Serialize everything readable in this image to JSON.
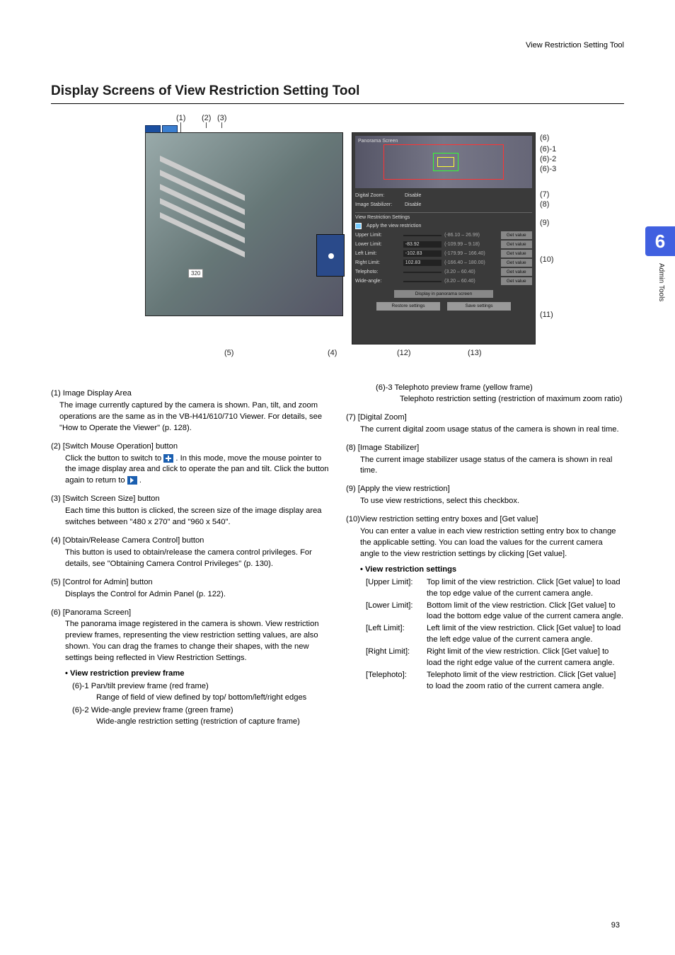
{
  "breadcrumb": "View Restriction Setting Tool",
  "section_title": "Display Screens of View Restriction Setting Tool",
  "chapter_tab": "6",
  "side_label": "Admin Tools",
  "page_number": "93",
  "figure": {
    "size_badge": "320",
    "panel": {
      "pano_title": "Panorama Screen",
      "dz_label": "Digital Zoom:",
      "dz_value": "Disable",
      "is_label": "Image Stabilizer:",
      "is_value": "Disable",
      "vrs_title": "View Restriction Settings",
      "apply_label": "Apply the view restriction",
      "rows": [
        {
          "label": "Upper Limit:",
          "val": "",
          "range": "(-86.10 – 26.99)",
          "btn": "Get value"
        },
        {
          "label": "Lower Limit:",
          "val": "-83.92",
          "range": "(-109.99 – 9.18)",
          "btn": "Get value"
        },
        {
          "label": "Left Limit:",
          "val": "-102.83",
          "range": "(-179.99 – 166.40)",
          "btn": "Get value"
        },
        {
          "label": "Right Limit:",
          "val": "102.83",
          "range": "(-166.40 – 180.00)",
          "btn": "Get value"
        },
        {
          "label": "Telephoto:",
          "val": "",
          "range": "(3.20 – 60.40)",
          "btn": "Get value"
        },
        {
          "label": "Wide-angle:",
          "val": "",
          "range": "(3.20 – 60.40)",
          "btn": "Get value"
        }
      ],
      "disp_btn": "Display in panorama screen",
      "restore_btn": "Restore settings",
      "save_btn": "Save settings"
    },
    "callouts_top": {
      "c1": "(1)",
      "c2": "(2)",
      "c3": "(3)"
    },
    "callouts_right": {
      "c6": "(6)",
      "c6_1": "(6)-1",
      "c6_2": "(6)-2",
      "c6_3": "(6)-3",
      "c7": "(7)",
      "c8": "(8)",
      "c9": "(9)",
      "c10": "(10)",
      "c11": "(11)"
    },
    "callouts_bottom": {
      "c5": "(5)",
      "c4": "(4)",
      "c12": "(12)",
      "c13": "(13)"
    }
  },
  "left_col": {
    "i1_h": "(1) Image Display Area",
    "i1_b": "The image currently captured by the camera is shown. Pan, tilt, and zoom operations are the same as in the VB-H41/610/710 Viewer. For details, see \"How to Operate the Viewer\" (p. 128).",
    "i2_h": "(2) [Switch Mouse Operation] button",
    "i2_b1": "Click the button to switch to ",
    "i2_b2": ". In this mode, move the mouse pointer to the image display area and click to operate the pan and tilt. Click the button again to return to ",
    "i2_b3": ".",
    "i3_h": "(3) [Switch Screen Size] button",
    "i3_b": "Each time this button is clicked, the screen size of the image display area switches between \"480 x 270\" and \"960 x 540\".",
    "i4_h": "(4) [Obtain/Release Camera Control] button",
    "i4_b": "This button is used to obtain/release the camera control privileges. For details, see \"Obtaining Camera Control Privileges\" (p. 130).",
    "i5_h": "(5) [Control for Admin] button",
    "i5_b": "Displays the Control for Admin Panel (p. 122).",
    "i6_h": "(6) [Panorama Screen]",
    "i6_b": "The panorama image registered in the camera is shown. View restriction preview frames, representing the view restriction setting values, are also shown. You can drag the frames to change their shapes, with the new settings being reflected in View Restriction Settings.",
    "i6_sub_h": "View restriction preview frame",
    "i6_1a": "(6)-1 Pan/tilt preview frame (red frame)",
    "i6_1b": "Range of field of view defined by top/ bottom/left/right edges",
    "i6_2a": "(6)-2 Wide-angle preview frame (green frame)",
    "i6_2b": "Wide-angle restriction setting (restriction of capture frame)"
  },
  "right_col": {
    "i6_3a": "(6)-3 Telephoto preview frame (yellow frame)",
    "i6_3b": "Telephoto restriction setting (restriction of maximum zoom ratio)",
    "i7_h": "(7) [Digital Zoom]",
    "i7_b": "The current digital zoom usage status of the camera is shown in real time.",
    "i8_h": "(8) [Image Stabilizer]",
    "i8_b": "The current image stabilizer usage status of the camera is shown in real time.",
    "i9_h": "(9) [Apply the view restriction]",
    "i9_b": "To use view restrictions, select this checkbox.",
    "i10_h": "(10)View restriction setting entry boxes and [Get value]",
    "i10_b": "You can enter a value in each view restriction setting entry box to change the applicable setting. You can load the values for the current camera angle to the view restriction settings by clicking [Get value].",
    "i10_sub_h": "View restriction settings",
    "kv": [
      {
        "k": "[Upper Limit]:",
        "v": "Top limit of the view restriction. Click [Get value] to load the top edge value of the current camera angle."
      },
      {
        "k": "[Lower Limit]:",
        "v": "Bottom limit of the view restriction. Click [Get value] to load the bottom edge value of the current camera angle."
      },
      {
        "k": "[Left Limit]:",
        "v": "Left limit of the view restriction. Click [Get value] to load the left edge value of the current camera angle."
      },
      {
        "k": "[Right Limit]:",
        "v": "Right limit of the view restriction. Click [Get value] to load the right edge value of the current camera angle."
      },
      {
        "k": "[Telephoto]:",
        "v": "Telephoto limit of the view restriction. Click [Get value] to load the zoom ratio of the current camera angle."
      }
    ]
  }
}
